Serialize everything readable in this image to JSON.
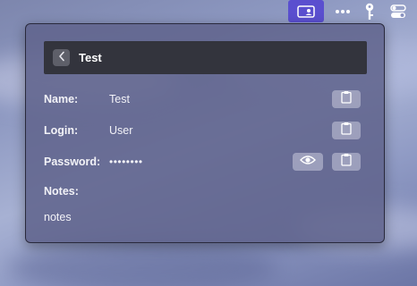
{
  "detail": {
    "title": "Test",
    "fields": {
      "name_label": "Name:",
      "name_value": "Test",
      "login_label": "Login:",
      "login_value": "User",
      "password_label": "Password:",
      "password_value": "••••••••",
      "notes_label": "Notes:",
      "notes_value": "notes"
    }
  },
  "icons": {
    "back": "chevron-left-icon",
    "copy": "clipboard-icon",
    "reveal": "eye-icon",
    "menubar": [
      "contact-card-icon",
      "more-icon",
      "key-icon",
      "control-center-icon"
    ]
  },
  "colors": {
    "menubar_active": "#5a4fcf",
    "header_bg": "#33343d",
    "popover_bg": "#60638c"
  }
}
